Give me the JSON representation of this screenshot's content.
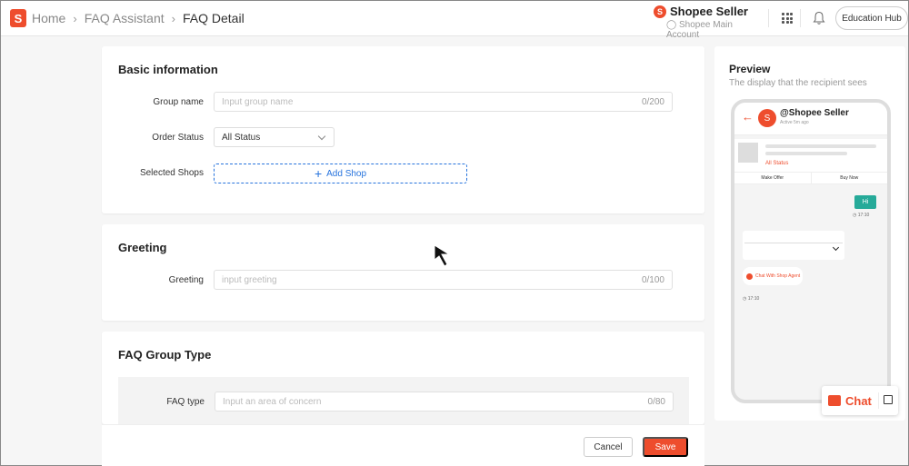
{
  "breadcrumb": {
    "logo_letter": "S",
    "items": [
      "Home",
      "FAQ Assistant",
      "FAQ Detail"
    ]
  },
  "header": {
    "seller_name": "Shopee Seller",
    "account_label": "Shopee Main Account",
    "education_hub": "Education Hub"
  },
  "basic_info": {
    "title": "Basic information",
    "group_name_label": "Group name",
    "group_name_placeholder": "Input group name",
    "group_name_counter": "0/200",
    "order_status_label": "Order Status",
    "order_status_value": "All Status",
    "selected_shops_label": "Selected Shops",
    "add_shop_label": "Add Shop"
  },
  "greeting": {
    "title": "Greeting",
    "label": "Greeting",
    "placeholder": "input greeting",
    "counter": "0/100"
  },
  "faq_group": {
    "title": "FAQ Group Type",
    "faq_type_label": "FAQ type",
    "faq_type_placeholder": "Input an area of concern",
    "faq_type_counter": "0/80"
  },
  "footer": {
    "cancel": "Cancel",
    "save": "Save"
  },
  "preview": {
    "title": "Preview",
    "subtitle": "The display that the recipient sees",
    "shop_name": "@Shopee Seller",
    "active_text": "Active 5m ago",
    "product_status": "All Status",
    "make_offer": "Make Offer",
    "buy_now": "Buy Now",
    "hi_message": "Hi",
    "time_1": "17:10",
    "agent_text": "Chat With Shop Agent",
    "time_2": "17:10"
  },
  "chat_widget": {
    "label": "Chat"
  },
  "colors": {
    "brand": "#ee4d2d",
    "link_blue": "#2673dd",
    "chat_bubble": "#26aa99"
  }
}
